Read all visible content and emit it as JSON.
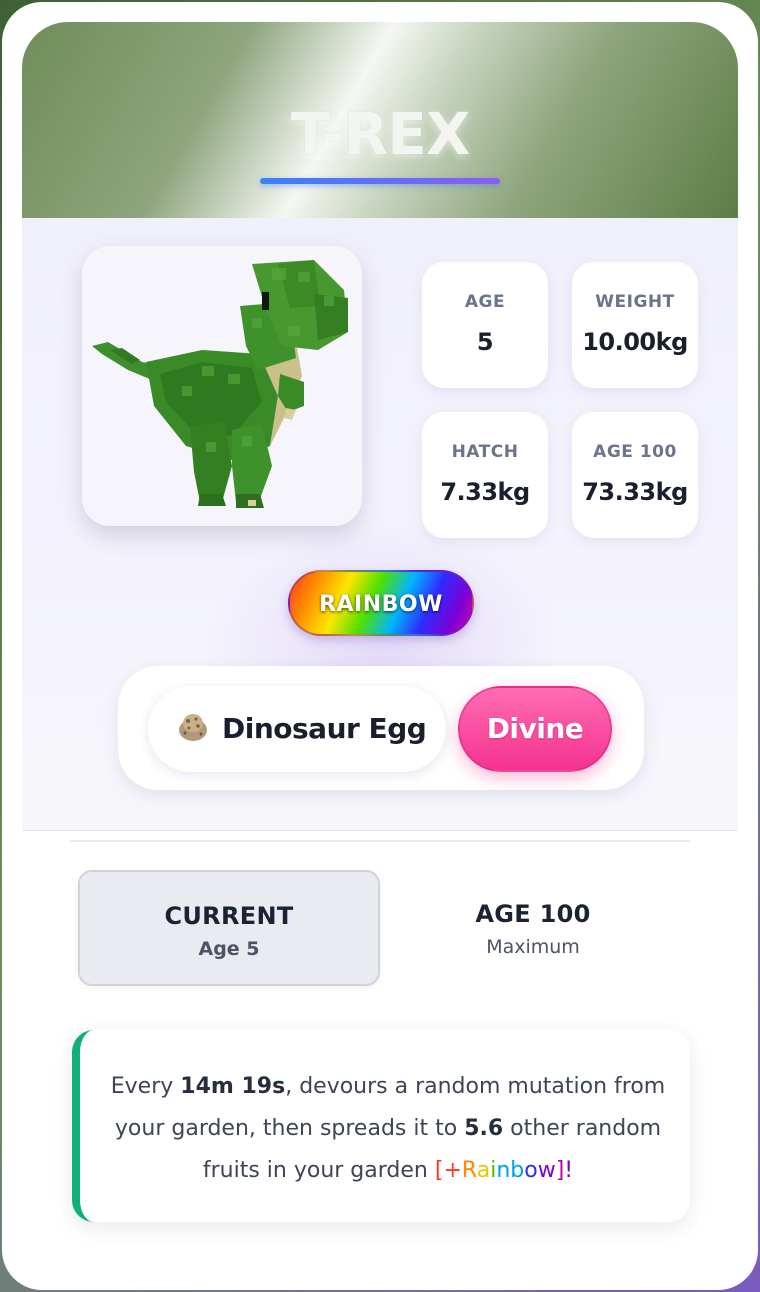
{
  "pet": {
    "name": "T-REX",
    "image_label": "T-Rex pet"
  },
  "stats": {
    "age": {
      "label": "AGE",
      "value": "5"
    },
    "weight": {
      "label": "WEIGHT",
      "value": "10.00kg"
    },
    "hatch": {
      "label": "HATCH",
      "value": "7.33kg"
    },
    "age100": {
      "label": "AGE 100",
      "value": "73.33kg"
    }
  },
  "mutation_badge": "RAINBOW",
  "egg": {
    "icon": "dinosaur-egg-icon",
    "label": "Dinosaur Egg"
  },
  "rarity": "Divine",
  "tabs": {
    "current": {
      "title": "CURRENT",
      "subtitle": "Age 5"
    },
    "max": {
      "title": "AGE 100",
      "subtitle": "Maximum"
    }
  },
  "ability": {
    "p1": "Every ",
    "interval": "14m 19s",
    "p2": ", devours a random mutation from your garden, then spreads it to ",
    "count": "5.6",
    "p3": " other random fruits in your garden ",
    "tag": "[+Rainbow]",
    "tag_colors": [
      "#ff3b1f",
      "#ff8a00",
      "#e6c800",
      "#44c200",
      "#00a0e6",
      "#2f2cff",
      "#7b00d6",
      "#c400a8"
    ],
    "p4": "!"
  },
  "colors": {
    "title_underline": [
      "#3b82f6",
      "#8b5cf6"
    ],
    "rarity_divine": "#f5338f",
    "ability_accent": "#10b07a"
  }
}
